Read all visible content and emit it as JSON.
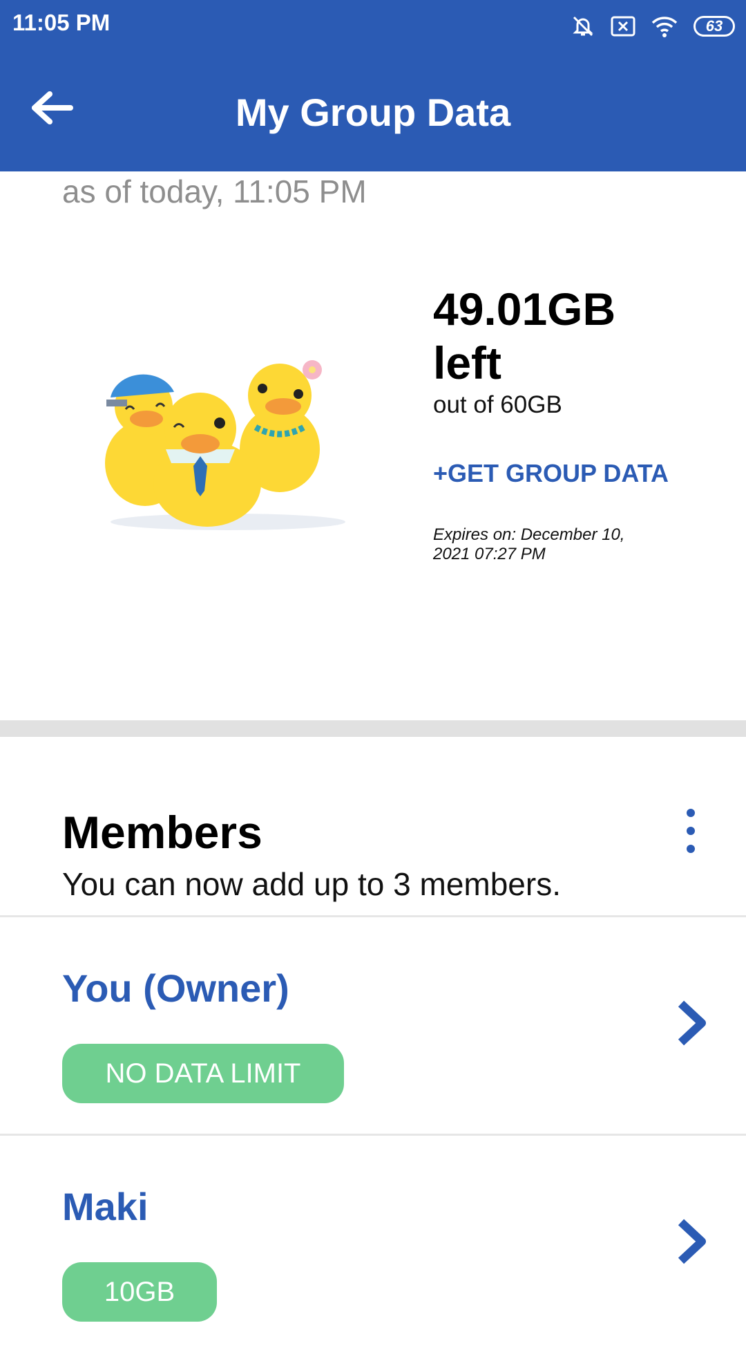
{
  "status_bar": {
    "time": "11:05 PM",
    "battery": "63",
    "icons": [
      "bell-off-icon",
      "sim-x-icon",
      "wifi-icon",
      "battery-icon"
    ]
  },
  "app_bar": {
    "title": "My Group Data",
    "back_icon": "arrow-left-icon"
  },
  "summary": {
    "as_of": "as of today, 11:05 PM",
    "left_amount": "49.01GB",
    "left_word": "left",
    "out_of": "out of 60GB",
    "get_data_label": "+GET GROUP DATA",
    "expires_line1": "Expires on: December 10,",
    "expires_line2": "2021 07:27 PM",
    "illustration": "three-ducks-illustration"
  },
  "members": {
    "title": "Members",
    "subtitle": "You can now add up to 3 members.",
    "menu_icon": "more-vert-icon",
    "list": [
      {
        "name": "You (Owner)",
        "badge": "NO DATA LIMIT"
      },
      {
        "name": "Maki",
        "badge": "10GB"
      }
    ]
  },
  "colors": {
    "primary": "#2b5bb4",
    "badge": "#6fcf90",
    "duck_yellow": "#fdd835",
    "beak_orange": "#f39a3a"
  }
}
